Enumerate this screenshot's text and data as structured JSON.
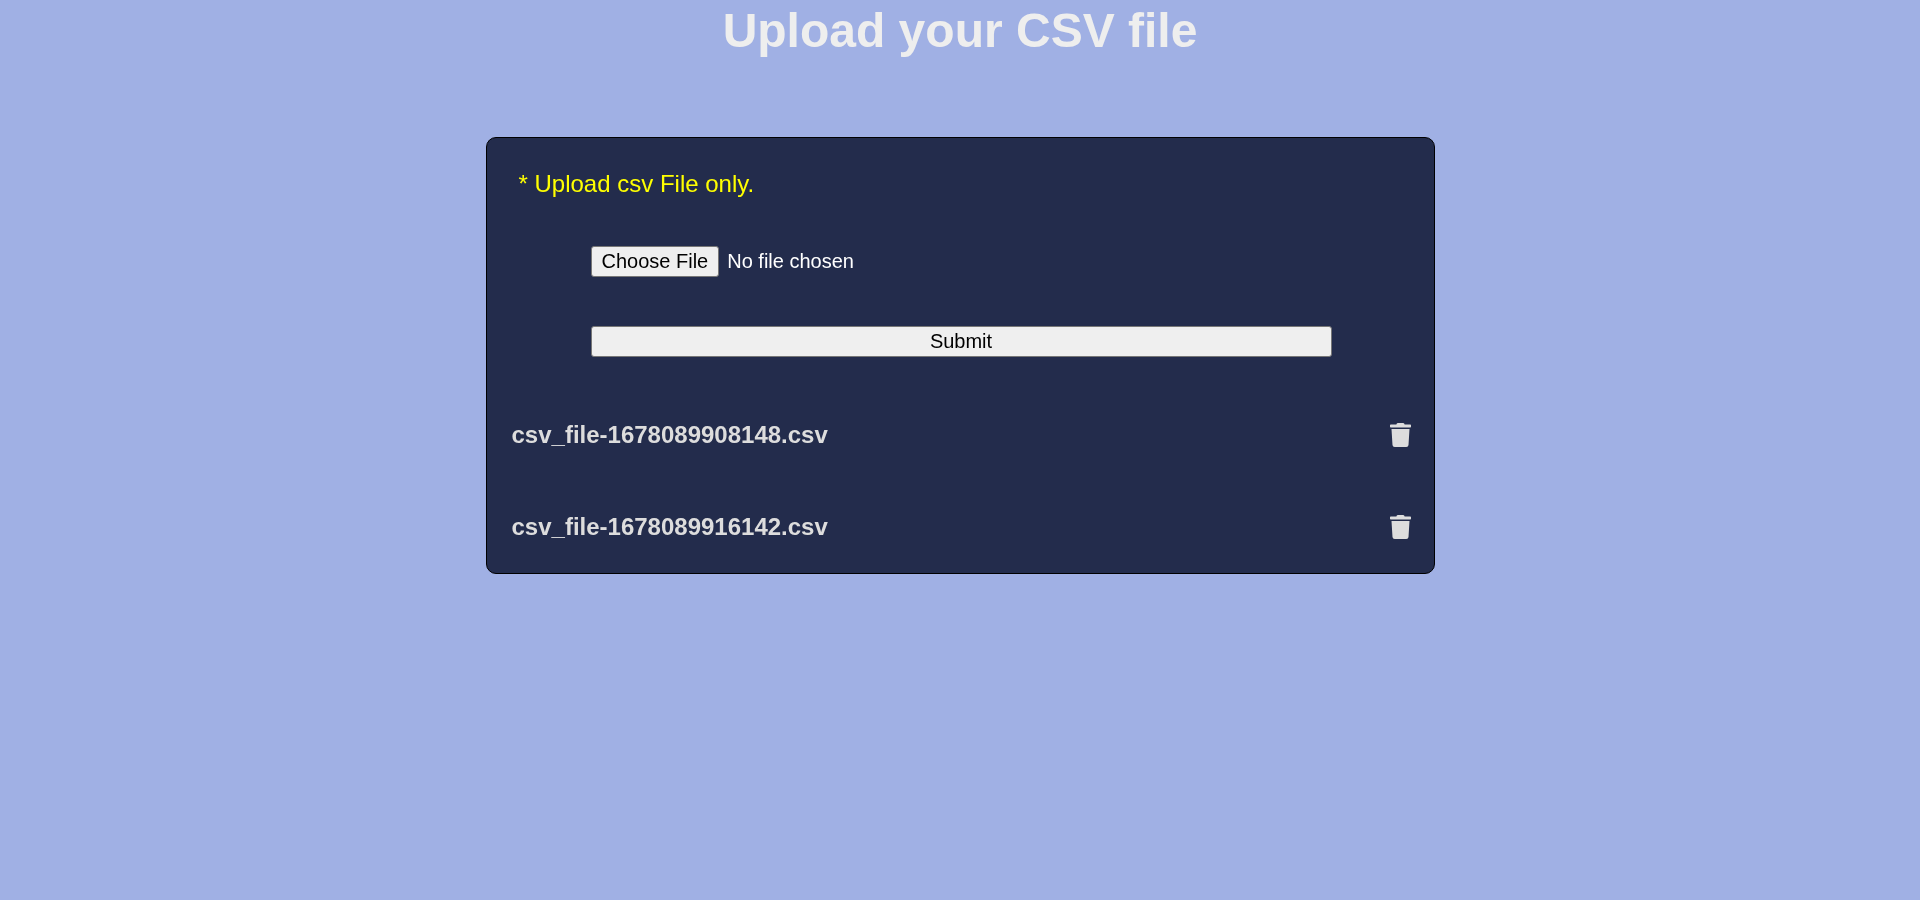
{
  "page": {
    "title": "Upload your CSV file"
  },
  "upload_card": {
    "note": "* Upload csv File only.",
    "file_input": {
      "button": "Choose File",
      "status": "No file chosen"
    },
    "submit_button": "Submit",
    "files": [
      {
        "name": "csv_file-1678089908148.csv"
      },
      {
        "name": "csv_file-1678089916142.csv"
      }
    ]
  }
}
